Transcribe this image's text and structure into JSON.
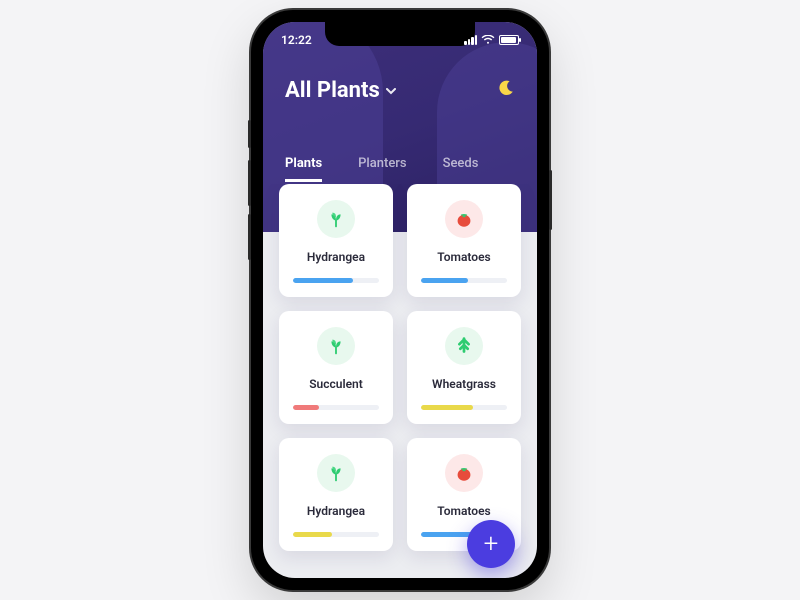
{
  "status": {
    "time": "12:22"
  },
  "header": {
    "title": "All Plants",
    "moon_icon": "moon-icon"
  },
  "tabs": [
    {
      "label": "Plants",
      "active": true
    },
    {
      "label": "Planters",
      "active": false
    },
    {
      "label": "Seeds",
      "active": false
    }
  ],
  "cards": [
    {
      "name": "Hydrangea",
      "icon": "leaf",
      "icon_bg": "#e8f8ee",
      "progress": 70,
      "bar_color": "#4aa3f0"
    },
    {
      "name": "Tomatoes",
      "icon": "tomato",
      "icon_bg": "#fde8e8",
      "progress": 55,
      "bar_color": "#4aa3f0"
    },
    {
      "name": "Succulent",
      "icon": "leaf",
      "icon_bg": "#e8f8ee",
      "progress": 30,
      "bar_color": "#f07a7a"
    },
    {
      "name": "Wheatgrass",
      "icon": "sprout",
      "icon_bg": "#e8f8ee",
      "progress": 60,
      "bar_color": "#e9d94a"
    },
    {
      "name": "Hydrangea",
      "icon": "leaf",
      "icon_bg": "#e8f8ee",
      "progress": 45,
      "bar_color": "#e9d94a"
    },
    {
      "name": "Tomatoes",
      "icon": "tomato",
      "icon_bg": "#fde8e8",
      "progress": 65,
      "bar_color": "#4aa3f0"
    }
  ],
  "fab": {
    "label": "+"
  },
  "colors": {
    "accent": "#4b3de0"
  }
}
